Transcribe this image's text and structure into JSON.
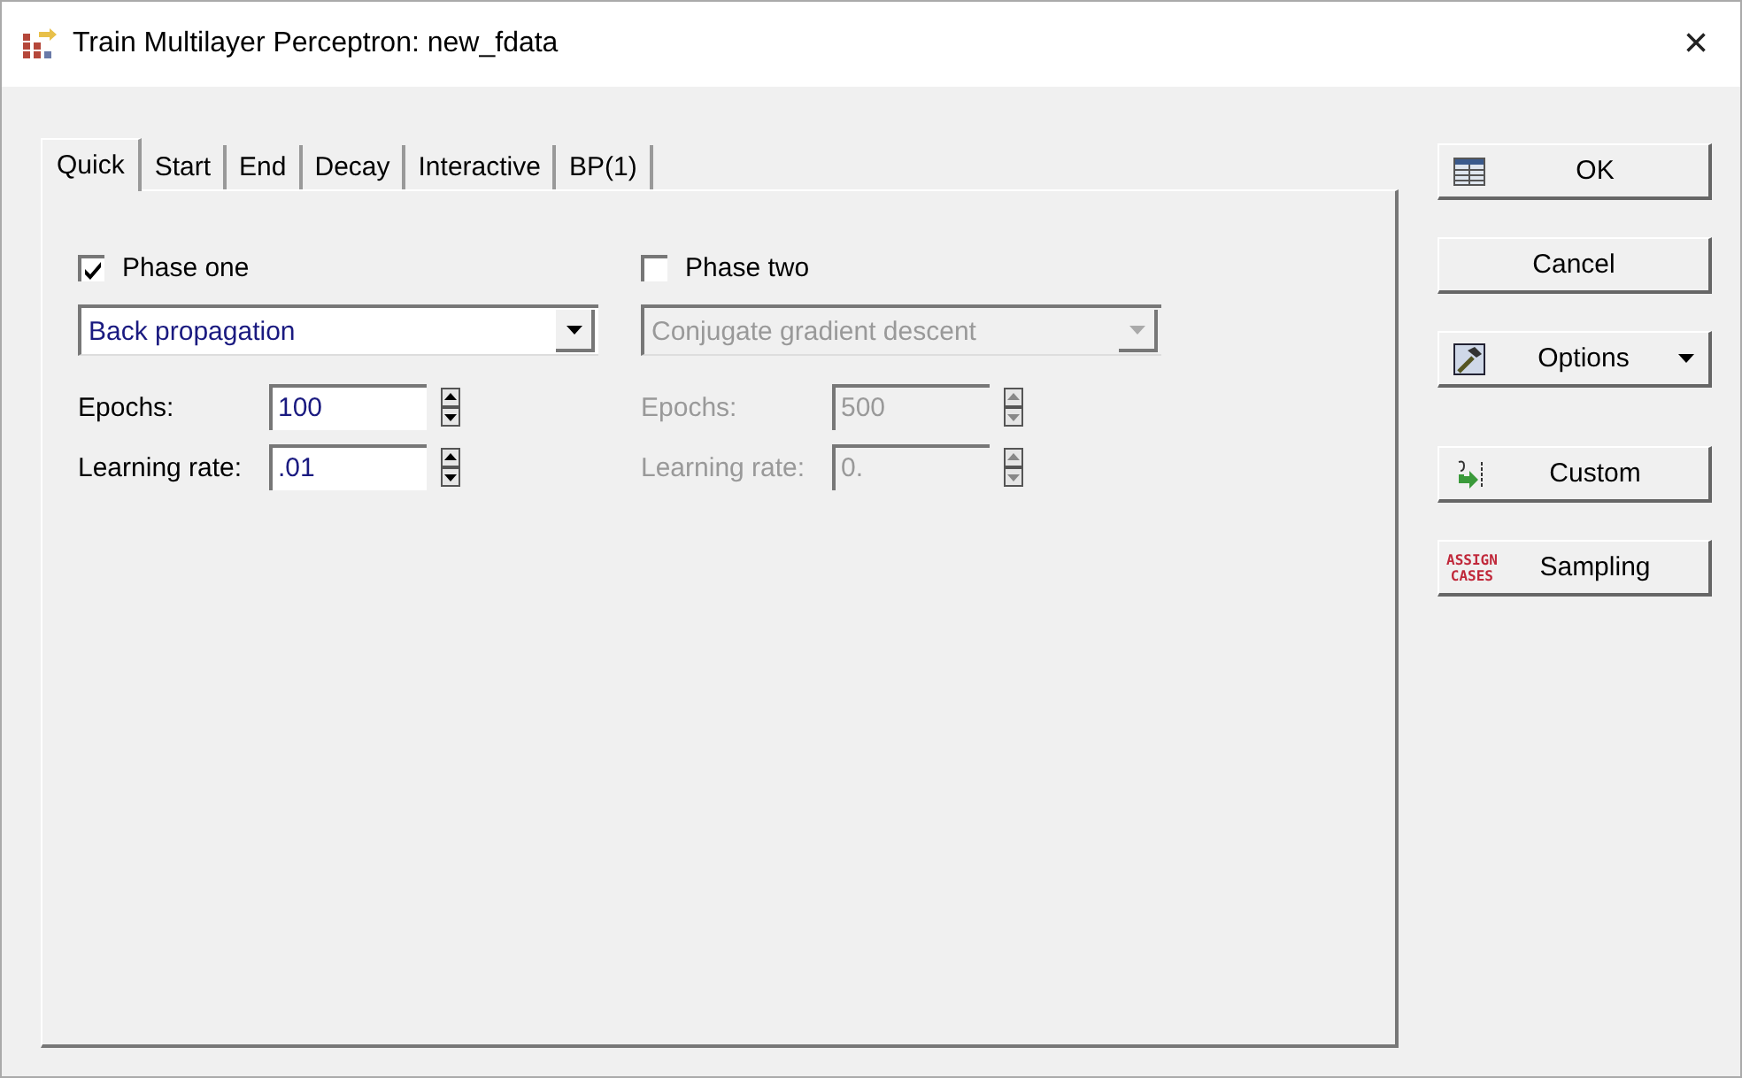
{
  "window": {
    "title": "Train Multilayer Perceptron: new_fdata",
    "close": "×"
  },
  "tabs": [
    {
      "label": "Quick",
      "selected": true
    },
    {
      "label": "Start",
      "selected": false
    },
    {
      "label": "End",
      "selected": false
    },
    {
      "label": "Decay",
      "selected": false
    },
    {
      "label": "Interactive",
      "selected": false
    },
    {
      "label": "BP(1)",
      "selected": false
    }
  ],
  "phases": [
    {
      "label": "Phase one",
      "checked": true,
      "disabled": false,
      "algorithm": "Back propagation",
      "fields": [
        {
          "label": "Epochs:",
          "value": "100"
        },
        {
          "label": "Learning rate:",
          "value": ".01"
        }
      ]
    },
    {
      "label": "Phase two",
      "checked": false,
      "disabled": true,
      "algorithm": "Conjugate gradient descent",
      "fields": [
        {
          "label": "Epochs:",
          "value": "500"
        },
        {
          "label": "Learning rate:",
          "value": "0."
        }
      ]
    }
  ],
  "buttons": [
    {
      "kind": "grid",
      "label": "OK",
      "dropdown": false
    },
    {
      "kind": "none",
      "label": "Cancel",
      "dropdown": false
    },
    {
      "kind": "tool",
      "label": "Options",
      "dropdown": true
    },
    {
      "kind": "arrow",
      "label": "Custom",
      "dropdown": false
    },
    {
      "kind": "assign",
      "label": "Sampling",
      "dropdown": false,
      "icon_text": [
        "ASSIGN",
        "CASES"
      ]
    }
  ]
}
